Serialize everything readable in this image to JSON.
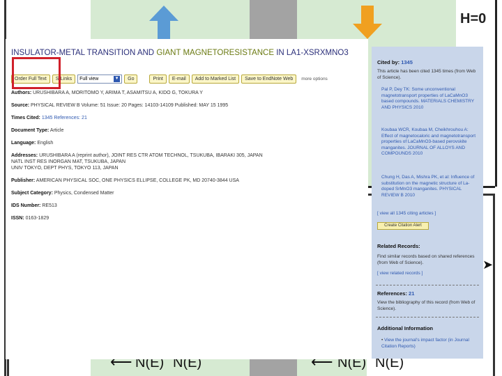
{
  "slide": {
    "h_label": "H=0",
    "ne_labels": [
      "N(E)",
      "N(E)",
      "N(E)",
      "N(E)"
    ],
    "up_arrow_color": "#5b9bd5",
    "down_arrow_color": "#f0a020"
  },
  "record": {
    "title_part1": "INSULATOR-METAL TRANSITION AND ",
    "title_highlight": "GIANT MAGNETORESISTANCE",
    "title_part2": " IN LA1-XSRXMNO3",
    "toolbar": {
      "full_text": "Order Full Text",
      "links": "S-Links",
      "select_value": "Full view",
      "go": "Go",
      "print": "Print",
      "email": "E-mail",
      "marked_list": "Add to Marked List",
      "endnote": "Save to EndNote Web",
      "more": "more options"
    },
    "fields": [
      {
        "label": "Authors:",
        "value": "URUSHIBARA A, MORITOMO Y, ARIMA T, ASAMITSU A, KIDO G, TOKURA Y"
      },
      {
        "label": "Source:",
        "value": "PHYSICAL REVIEW B   Volume: 51   Issue: 20   Pages: 14103-14109   Published: MAY 15 1995"
      },
      {
        "label": "Times Cited:",
        "value": "1345   References: 21"
      },
      {
        "label": "Document Type:",
        "value": "Article"
      },
      {
        "label": "Language:",
        "value": "English"
      },
      {
        "label": "Addresses:",
        "value": "URUSHIBARA A (reprint author), JOINT RES CTR ATOM TECHNOL, TSUKUBA, IBARAKI 305, JAPAN"
      },
      {
        "label": "",
        "value": "NATL INST RES INORGAN MAT, TSUKUBA, JAPAN"
      },
      {
        "label": "",
        "value": "UNIV TOKYO, DEPT PHYS, TOKYO 113, JAPAN"
      },
      {
        "label": "Publisher:",
        "value": "AMERICAN PHYSICAL SOC, ONE PHYSICS ELLIPSE, COLLEGE PK, MD 20740-3844 USA"
      },
      {
        "label": "Subject Category:",
        "value": "Physics, Condensed Matter"
      },
      {
        "label": "IDS Number:",
        "value": "RE513"
      },
      {
        "label": "ISSN:",
        "value": "0163-1829"
      }
    ]
  },
  "sidebar": {
    "cited_by_label": "Cited by:",
    "cited_by_count": "1345",
    "cited_intro": "This article has been cited 1345 times (from Web of Science).",
    "citing": [
      "Pal P, Dey TK: Some unconventional magnetotransport properties of LaCaMnO3 based compounds. MATERIALS CHEMISTRY AND PHYSICS 2010",
      "Koubaa WCR, Koubaa M, Cheikhrouhou A: Effect of magnetocaloric and magnetotransport properties of LaCaMnO3-based perovskite manganites. JOURNAL OF ALLOYS AND COMPOUNDS 2010",
      "Chung H, Das A, Mishra PK, et al: Influence of substitution on the magnetic structure of La-doped SrMnO3 manganites. PHYSICAL REVIEW B 2010"
    ],
    "view_all": "[ view all 1345 citing articles ]",
    "create_alert": "Create Citation Alert",
    "related_title": "Related Records:",
    "related_text": "Find similar records based on shared references (from Web of Science).",
    "view_related": "[ view related records ]",
    "references_label": "References:",
    "references_count": "21",
    "references_text": "View the bibliography of this record (from Web of Science).",
    "additional_title": "Additional Information",
    "additional_items": [
      "View the journal's impact factor (in Journal Citation Reports)"
    ]
  }
}
